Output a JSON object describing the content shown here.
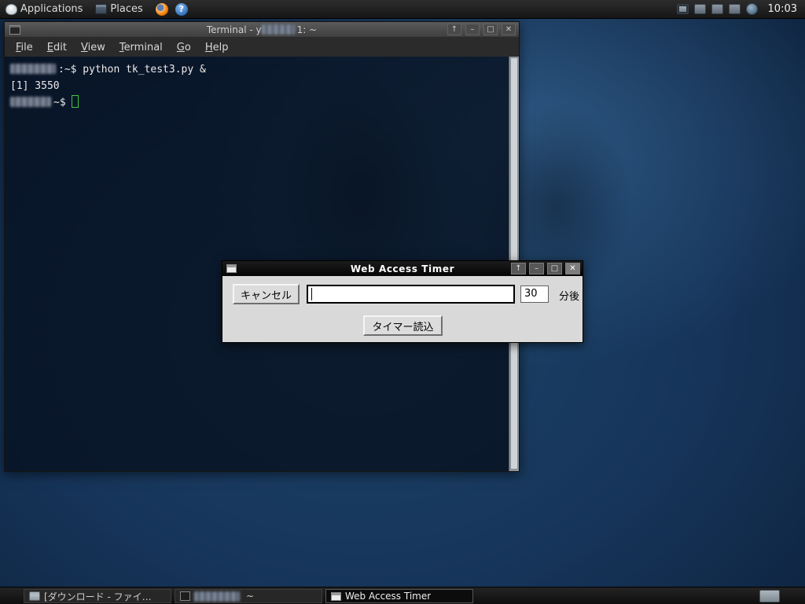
{
  "panel": {
    "applications_label": "Applications",
    "places_label": "Places",
    "clock": "10:03"
  },
  "icons": {
    "shade": "↑",
    "minimize": "–",
    "maximize": "□",
    "close": "✕",
    "help": "?"
  },
  "terminal_window": {
    "title_prefix": "Terminal - y",
    "title_suffix": "1: ~",
    "menu": [
      "File",
      "Edit",
      "View",
      "Terminal",
      "Go",
      "Help"
    ],
    "line1": ":~$ python tk_test3.py &",
    "line2": "[1] 3550",
    "line3_prompt": "~$"
  },
  "timer_window": {
    "title": "Web Access Timer",
    "cancel_button": "キャンセル",
    "url_entry_value": "",
    "minutes_entry_value": "30",
    "minutes_label": "分後",
    "load_button": "タイマー読込"
  },
  "taskbar": {
    "items": [
      {
        "label": "[ダウンロード - ファイ…"
      },
      {
        "label": "~"
      },
      {
        "label": "Web Access Timer"
      }
    ]
  }
}
